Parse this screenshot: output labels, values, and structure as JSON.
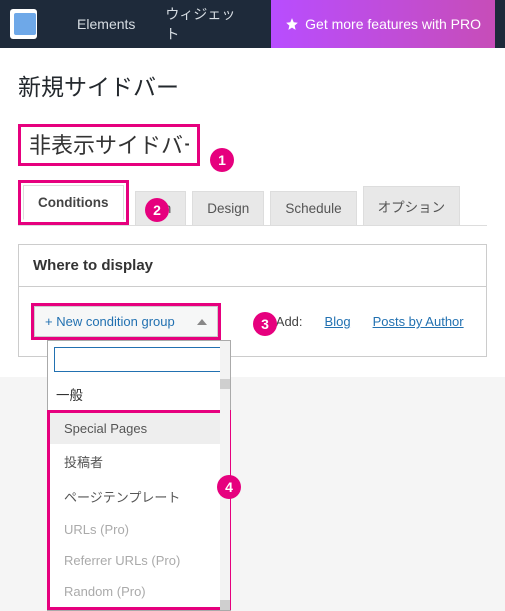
{
  "topnav": {
    "items": [
      "Elements",
      "ウィジェット"
    ],
    "pro_label": "Get more features with PRO"
  },
  "page_heading": "新規サイドバー",
  "title_input": {
    "value": "非表示サイドバー"
  },
  "tabs": {
    "conditions": "Conditions",
    "action": "tion",
    "design": "Design",
    "schedule": "Schedule",
    "options": "オプション"
  },
  "panel": {
    "header": "Where to display",
    "new_condition_group": "+ New condition group",
    "quick_add_label": "ick Add:",
    "quick_links": [
      "Blog",
      "Posts by Author"
    ]
  },
  "dropdown": {
    "search_value": "",
    "group_label": "一般",
    "items": [
      {
        "label": "Special Pages",
        "selected": true
      },
      {
        "label": "投稿者"
      },
      {
        "label": "ページテンプレート"
      },
      {
        "label": "URLs (Pro)",
        "disabled": true
      },
      {
        "label": "Referrer URLs (Pro)",
        "disabled": true
      },
      {
        "label": "Random (Pro)",
        "disabled": true
      }
    ]
  },
  "annotations": [
    "1",
    "2",
    "3",
    "4"
  ]
}
